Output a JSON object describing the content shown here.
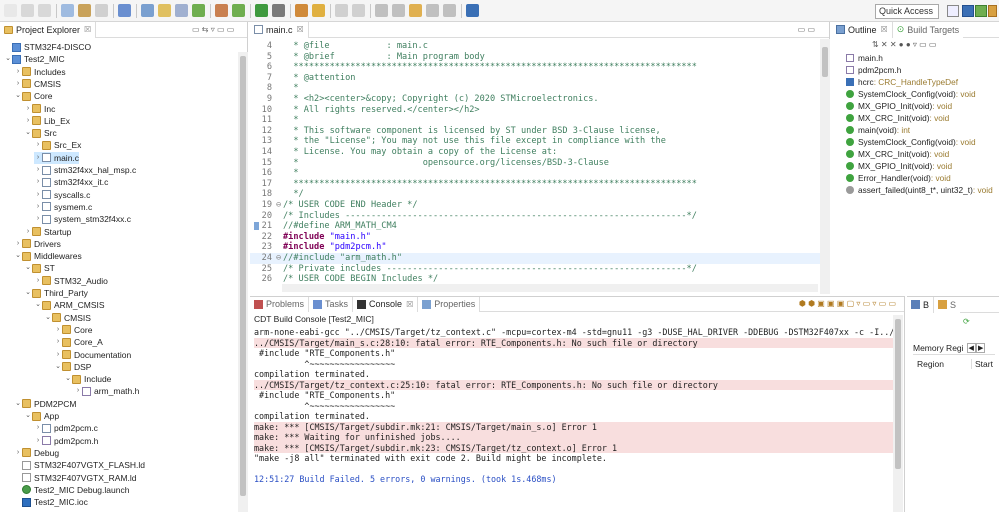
{
  "toolbar": {
    "quick_access_placeholder": "Quick Access"
  },
  "explorer": {
    "title": "Project Explorer",
    "close_glyph": "☒",
    "items": [
      {
        "label": "STM32F4-DISCO",
        "depth": 0,
        "icon": "project",
        "expanded": null
      },
      {
        "label": "Test2_MIC",
        "depth": 0,
        "icon": "project",
        "expanded": true
      },
      {
        "label": "Includes",
        "depth": 1,
        "icon": "folder",
        "expanded": false
      },
      {
        "label": "CMSIS",
        "depth": 1,
        "icon": "folder",
        "expanded": false
      },
      {
        "label": "Core",
        "depth": 1,
        "icon": "srcfolder",
        "expanded": true
      },
      {
        "label": "Inc",
        "depth": 2,
        "icon": "folder",
        "expanded": false
      },
      {
        "label": "Lib_Ex",
        "depth": 2,
        "icon": "folder",
        "expanded": false
      },
      {
        "label": "Src",
        "depth": 2,
        "icon": "folder",
        "expanded": true
      },
      {
        "label": "Src_Ex",
        "depth": 3,
        "icon": "folder",
        "expanded": false
      },
      {
        "label": "main.c",
        "depth": 3,
        "icon": "cfile",
        "expanded": false,
        "selected": true
      },
      {
        "label": "stm32f4xx_hal_msp.c",
        "depth": 3,
        "icon": "cfile",
        "expanded": false
      },
      {
        "label": "stm32f4xx_it.c",
        "depth": 3,
        "icon": "cfile",
        "expanded": false
      },
      {
        "label": "syscalls.c",
        "depth": 3,
        "icon": "cfile",
        "expanded": false
      },
      {
        "label": "sysmem.c",
        "depth": 3,
        "icon": "cfile",
        "expanded": false
      },
      {
        "label": "system_stm32f4xx.c",
        "depth": 3,
        "icon": "cfile",
        "expanded": false
      },
      {
        "label": "Startup",
        "depth": 2,
        "icon": "folder",
        "expanded": false
      },
      {
        "label": "Drivers",
        "depth": 1,
        "icon": "srcfolder",
        "expanded": false
      },
      {
        "label": "Middlewares",
        "depth": 1,
        "icon": "srcfolder",
        "expanded": true
      },
      {
        "label": "ST",
        "depth": 2,
        "icon": "folder",
        "expanded": true
      },
      {
        "label": "STM32_Audio",
        "depth": 3,
        "icon": "folder",
        "expanded": false
      },
      {
        "label": "Third_Party",
        "depth": 2,
        "icon": "folder",
        "expanded": true
      },
      {
        "label": "ARM_CMSIS",
        "depth": 3,
        "icon": "folder",
        "expanded": true
      },
      {
        "label": "CMSIS",
        "depth": 4,
        "icon": "folder",
        "expanded": true
      },
      {
        "label": "Core",
        "depth": 5,
        "icon": "folder",
        "expanded": false
      },
      {
        "label": "Core_A",
        "depth": 5,
        "icon": "folder",
        "expanded": false
      },
      {
        "label": "Documentation",
        "depth": 5,
        "icon": "folder",
        "expanded": false
      },
      {
        "label": "DSP",
        "depth": 5,
        "icon": "folder",
        "expanded": true
      },
      {
        "label": "Include",
        "depth": 6,
        "icon": "folder",
        "expanded": true
      },
      {
        "label": "arm_math.h",
        "depth": 7,
        "icon": "hfile",
        "expanded": false
      },
      {
        "label": "PDM2PCM",
        "depth": 1,
        "icon": "srcfolder",
        "expanded": true
      },
      {
        "label": "App",
        "depth": 2,
        "icon": "folder",
        "expanded": true
      },
      {
        "label": "pdm2pcm.c",
        "depth": 3,
        "icon": "cfile",
        "expanded": false
      },
      {
        "label": "pdm2pcm.h",
        "depth": 3,
        "icon": "hfile",
        "expanded": false
      },
      {
        "label": "Debug",
        "depth": 1,
        "icon": "folder",
        "expanded": false
      },
      {
        "label": "STM32F407VGTX_FLASH.ld",
        "depth": 1,
        "icon": "file",
        "expanded": null
      },
      {
        "label": "STM32F407VGTX_RAM.ld",
        "depth": 1,
        "icon": "file",
        "expanded": null
      },
      {
        "label": "Test2_MIC Debug.launch",
        "depth": 1,
        "icon": "launch",
        "expanded": null
      },
      {
        "label": "Test2_MIC.ioc",
        "depth": 1,
        "icon": "ioc",
        "expanded": null
      }
    ]
  },
  "editor": {
    "tab_label": "main.c",
    "close_glyph": "☒",
    "lines": [
      {
        "num": "4",
        "fold": "",
        "parts": [
          {
            "t": "  * @file           : main.c",
            "c": "cmt"
          }
        ]
      },
      {
        "num": "5",
        "fold": "",
        "parts": [
          {
            "t": "  * @brief          : Main program body",
            "c": "cmt"
          }
        ]
      },
      {
        "num": "6",
        "fold": "",
        "parts": [
          {
            "t": "  ******************************************************************************",
            "c": "cmt"
          }
        ]
      },
      {
        "num": "7",
        "fold": "",
        "parts": [
          {
            "t": "  * @attention",
            "c": "cmt"
          }
        ]
      },
      {
        "num": "8",
        "fold": "",
        "parts": [
          {
            "t": "  *",
            "c": "cmt"
          }
        ]
      },
      {
        "num": "9",
        "fold": "",
        "parts": [
          {
            "t": "  * <h2><center>&copy; Copyright (c) 2020 STMicroelectronics.",
            "c": "cmt"
          }
        ]
      },
      {
        "num": "10",
        "fold": "",
        "parts": [
          {
            "t": "  * All rights reserved.</center></h2>",
            "c": "cmt"
          }
        ]
      },
      {
        "num": "11",
        "fold": "",
        "parts": [
          {
            "t": "  *",
            "c": "cmt"
          }
        ]
      },
      {
        "num": "12",
        "fold": "",
        "parts": [
          {
            "t": "  * This software component is licensed by ST under BSD 3-Clause license,",
            "c": "cmt"
          }
        ]
      },
      {
        "num": "13",
        "fold": "",
        "parts": [
          {
            "t": "  * the \"License\"; You may not use this file except in compliance with the",
            "c": "cmt"
          }
        ]
      },
      {
        "num": "14",
        "fold": "",
        "parts": [
          {
            "t": "  * License. You may obtain a copy of the License at:",
            "c": "cmt"
          }
        ]
      },
      {
        "num": "15",
        "fold": "",
        "parts": [
          {
            "t": "  *                        opensource.org/licenses/BSD-3-Clause",
            "c": "cmt"
          }
        ]
      },
      {
        "num": "16",
        "fold": "",
        "parts": [
          {
            "t": "  *",
            "c": "cmt"
          }
        ]
      },
      {
        "num": "17",
        "fold": "",
        "parts": [
          {
            "t": "  ******************************************************************************",
            "c": "cmt"
          }
        ]
      },
      {
        "num": "18",
        "fold": "",
        "parts": [
          {
            "t": "  */",
            "c": "cmt"
          }
        ]
      },
      {
        "num": "19",
        "fold": "⊖",
        "parts": [
          {
            "t": "/* USER CODE END Header */",
            "c": "cmt"
          }
        ]
      },
      {
        "num": "20",
        "fold": "",
        "parts": [
          {
            "t": "/* Includes ------------------------------------------------------------------*/",
            "c": "cmt"
          }
        ]
      },
      {
        "num": "21",
        "fold": "",
        "parts": [
          {
            "t": "//#define ARM_MATH_CM4",
            "c": "cmt"
          }
        ]
      },
      {
        "num": "22",
        "fold": "",
        "parts": [
          {
            "t": "#include ",
            "c": "pp"
          },
          {
            "t": "\"main.h\"",
            "c": "str"
          }
        ]
      },
      {
        "num": "23",
        "fold": "",
        "parts": [
          {
            "t": "#include ",
            "c": "pp"
          },
          {
            "t": "\"pdm2pcm.h\"",
            "c": "str"
          }
        ]
      },
      {
        "num": "24",
        "fold": "⊖",
        "parts": [
          {
            "t": "//#include \"arm_math.h\"",
            "c": "cmt"
          }
        ],
        "highlight": true
      },
      {
        "num": "25",
        "fold": "",
        "parts": [
          {
            "t": "/* Private includes ----------------------------------------------------------*/",
            "c": "cmt"
          }
        ]
      },
      {
        "num": "26",
        "fold": "",
        "parts": [
          {
            "t": "/* USER CODE BEGIN Includes */",
            "c": "cmt"
          }
        ]
      }
    ]
  },
  "outline": {
    "tab_label": "Outline",
    "other_tab": "Build Targets",
    "items": [
      {
        "icon": "hfile",
        "name": "main.h",
        "ret": ""
      },
      {
        "icon": "hfile",
        "name": "pdm2pcm.h",
        "ret": ""
      },
      {
        "icon": "var",
        "name": "hcrc",
        "ret": " : CRC_HandleTypeDef"
      },
      {
        "icon": "green",
        "name": "SystemClock_Config(void)",
        "ret": " : void"
      },
      {
        "icon": "green-s",
        "name": "MX_GPIO_Init(void)",
        "ret": " : void"
      },
      {
        "icon": "green-s",
        "name": "MX_CRC_Init(void)",
        "ret": " : void"
      },
      {
        "icon": "green",
        "name": "main(void)",
        "ret": " : int"
      },
      {
        "icon": "green",
        "name": "SystemClock_Config(void)",
        "ret": " : void"
      },
      {
        "icon": "green-s",
        "name": "MX_CRC_Init(void)",
        "ret": " : void"
      },
      {
        "icon": "green-s",
        "name": "MX_GPIO_Init(void)",
        "ret": " : void"
      },
      {
        "icon": "green",
        "name": "Error_Handler(void)",
        "ret": " : void"
      },
      {
        "icon": "gray",
        "name": "assert_failed(uint8_t*, uint32_t)",
        "ret": " : void"
      }
    ]
  },
  "console": {
    "tabs": [
      "Problems",
      "Tasks",
      "Console",
      "Properties"
    ],
    "active_tab": "Console",
    "header": "CDT Build Console [Test2_MIC]",
    "lines": [
      {
        "t": "arm-none-eabi-gcc \"../CMSIS/Target/tz_context.c\" -mcpu=cortex-m4 -std=gnu11 -g3 -DUSE_HAL_DRIVER -DDEBUG -DSTM32F407xx -c -I../PDM2PCM/App",
        "c": ""
      },
      {
        "t": "../CMSIS/Target/main_s.c:28:10: fatal error: RTE_Components.h: No such file or directory",
        "c": "err"
      },
      {
        "t": " #include \"RTE_Components.h\"",
        "c": ""
      },
      {
        "t": "          ^~~~~~~~~~~~~~~~~~",
        "c": ""
      },
      {
        "t": "compilation terminated.",
        "c": ""
      },
      {
        "t": "../CMSIS/Target/tz_context.c:25:10: fatal error: RTE_Components.h: No such file or directory",
        "c": "err"
      },
      {
        "t": " #include \"RTE_Components.h\"",
        "c": ""
      },
      {
        "t": "          ^~~~~~~~~~~~~~~~~~",
        "c": ""
      },
      {
        "t": "compilation terminated.",
        "c": ""
      },
      {
        "t": "make: *** [CMSIS/Target/subdir.mk:21: CMSIS/Target/main_s.o] Error 1",
        "c": "err"
      },
      {
        "t": "make: *** Waiting for unfinished jobs....",
        "c": "err"
      },
      {
        "t": "make: *** [CMSIS/Target/subdir.mk:23: CMSIS/Target/tz_context.o] Error 1",
        "c": "err"
      },
      {
        "t": "\"make -j8 all\" terminated with exit code 2. Build might be incomplete.",
        "c": ""
      },
      {
        "t": "",
        "c": ""
      },
      {
        "t": "12:51:27 Build Failed. 5 errors, 0 warnings. (took 1s.468ms)",
        "c": "blue"
      }
    ]
  },
  "memory": {
    "tab_label": "B",
    "other_tab": "S",
    "title": "Memory Regi",
    "col1": "Region",
    "col2": "Start"
  }
}
